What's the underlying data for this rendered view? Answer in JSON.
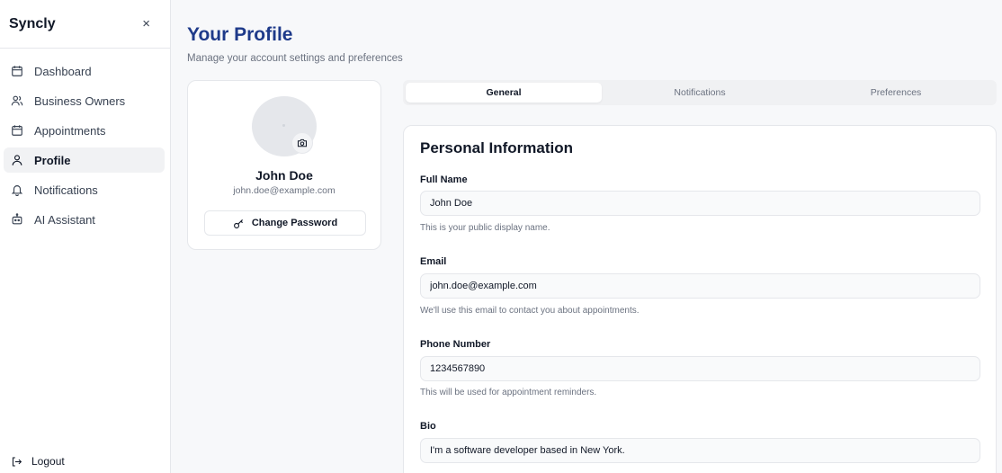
{
  "sidebar": {
    "brand": "Syncly",
    "close_icon": "×",
    "items": [
      {
        "label": "Dashboard",
        "icon": "calendar-icon"
      },
      {
        "label": "Business Owners",
        "icon": "users-icon"
      },
      {
        "label": "Appointments",
        "icon": "calendar-icon"
      },
      {
        "label": "Profile",
        "icon": "user-icon",
        "active": true
      },
      {
        "label": "Notifications",
        "icon": "bell-icon"
      },
      {
        "label": "AI Assistant",
        "icon": "bot-icon"
      }
    ],
    "logout_label": "Logout"
  },
  "header": {
    "title": "Your Profile",
    "subtitle": "Manage your account settings and preferences"
  },
  "profile_card": {
    "name": "John Doe",
    "email": "john.doe@example.com",
    "change_password_label": "Change Password"
  },
  "tabs": [
    {
      "label": "General",
      "active": true
    },
    {
      "label": "Notifications"
    },
    {
      "label": "Preferences"
    }
  ],
  "form": {
    "title": "Personal Information",
    "full_name": {
      "label": "Full Name",
      "value": "John Doe",
      "hint": "This is your public display name."
    },
    "email": {
      "label": "Email",
      "value": "john.doe@example.com",
      "hint": "We'll use this email to contact you about appointments."
    },
    "phone": {
      "label": "Phone Number",
      "value": "1234567890",
      "hint": "This will be used for appointment reminders."
    },
    "bio": {
      "label": "Bio",
      "value": "I'm a software developer based in New York."
    }
  },
  "colors": {
    "accent_title": "#1e3a8a",
    "active_nav_bg": "#f1f2f4",
    "page_bg": "#f7f8fa"
  }
}
